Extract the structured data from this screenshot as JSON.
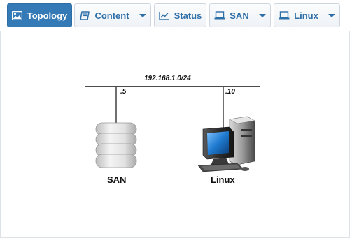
{
  "toolbar": {
    "tabs": [
      {
        "label": "Topology",
        "icon": "image-icon",
        "active": true,
        "dropdown": false
      },
      {
        "label": "Content",
        "icon": "book-icon",
        "active": false,
        "dropdown": true
      },
      {
        "label": "Status",
        "icon": "line-chart-icon",
        "active": false,
        "dropdown": false
      },
      {
        "label": "SAN",
        "icon": "laptop-icon",
        "active": false,
        "dropdown": true
      },
      {
        "label": "Linux",
        "icon": "laptop-icon",
        "active": false,
        "dropdown": true
      }
    ]
  },
  "colors": {
    "accent": "#337ab7",
    "tab_text": "#2f6fa8",
    "tab_border": "#cfd6df"
  },
  "topology": {
    "network": "192.168.1.0/24",
    "nodes": [
      {
        "name": "SAN",
        "address": ".5",
        "icon": "storage-stack-icon"
      },
      {
        "name": "Linux",
        "address": ".10",
        "icon": "desktop-computer-icon"
      }
    ]
  }
}
